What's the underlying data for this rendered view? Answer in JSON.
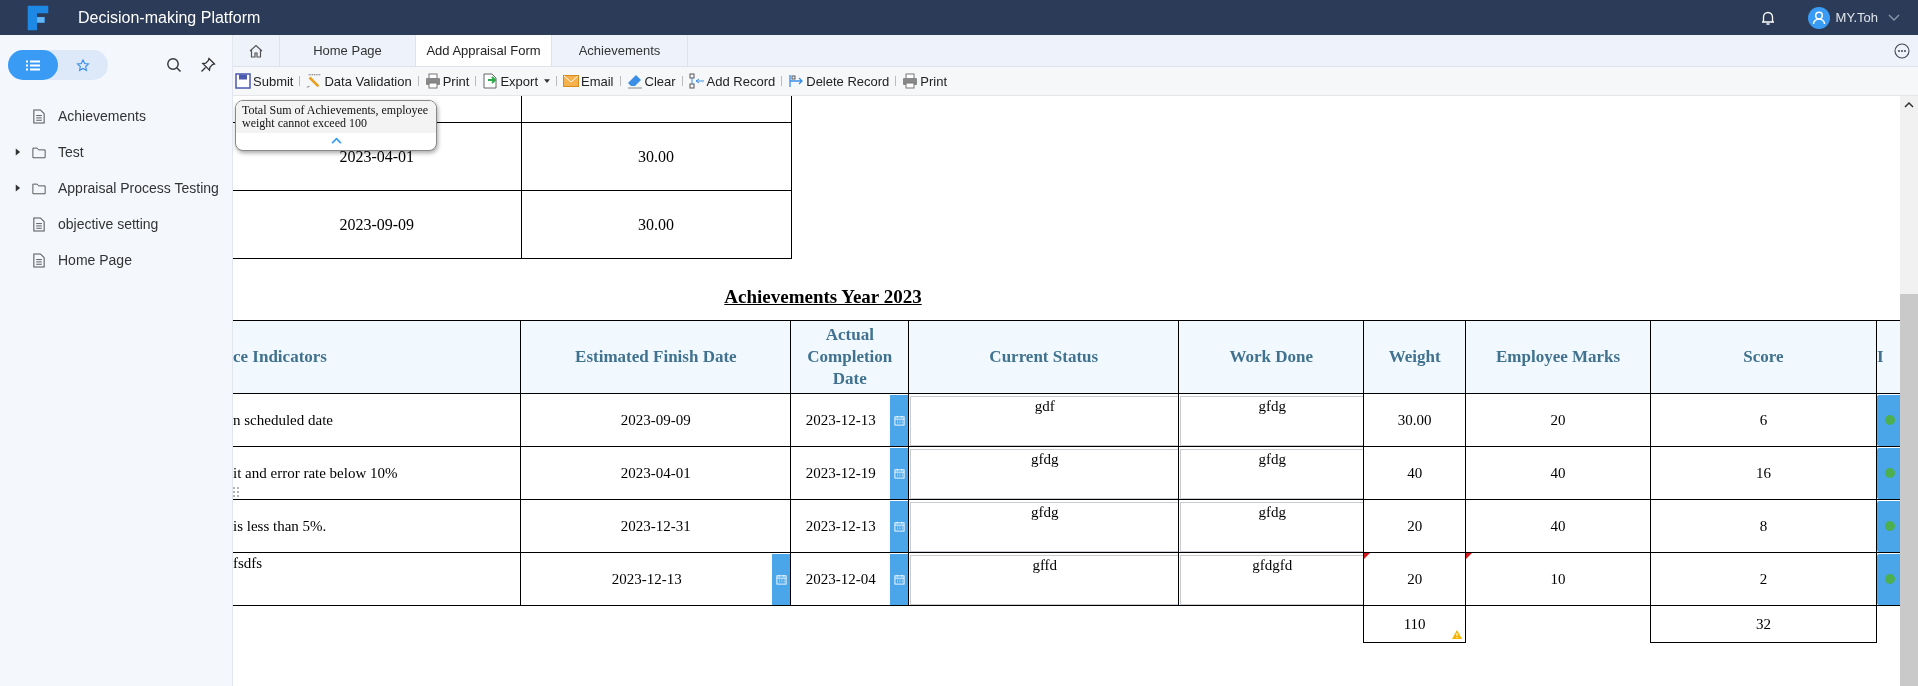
{
  "app": {
    "title": "Decision-making Platform",
    "user": "MY.Toh"
  },
  "sidebar": {
    "views": [
      {
        "kind": "list",
        "selected": true
      },
      {
        "kind": "favorites",
        "selected": false
      }
    ],
    "items": [
      {
        "label": "Achievements",
        "kind": "file"
      },
      {
        "label": "Test",
        "kind": "folder",
        "expanded": false
      },
      {
        "label": "Appraisal Process Testing",
        "kind": "folder",
        "expanded": false
      },
      {
        "label": "objective setting",
        "kind": "file"
      },
      {
        "label": "Home Page",
        "kind": "file"
      }
    ]
  },
  "tabs": [
    {
      "label": "Home Page",
      "selected": false
    },
    {
      "label": "Add Appraisal Form",
      "selected": true
    },
    {
      "label": "Achievements",
      "selected": false
    }
  ],
  "toolbar": [
    {
      "label": "Submit",
      "kind": "submit"
    },
    {
      "label": "Data Validation",
      "kind": "validate"
    },
    {
      "label": "Print",
      "kind": "print"
    },
    {
      "label": "Export",
      "kind": "export"
    },
    {
      "label": "Email",
      "kind": "email"
    },
    {
      "label": "Clear",
      "kind": "clear"
    },
    {
      "label": "Add Record",
      "kind": "add"
    },
    {
      "label": "Delete Record",
      "kind": "delete"
    },
    {
      "label": "Print",
      "kind": "print"
    }
  ],
  "tooltip": "Total Sum of Achievements, employee weight cannot exceed 100",
  "top_table": {
    "rows": [
      {
        "date": "2023-04-01",
        "value": "30.00"
      },
      {
        "date": "2023-09-09",
        "value": "30.00"
      }
    ]
  },
  "achievements": {
    "title": "Achievements Year 2023",
    "columns": [
      "ce Indicators",
      "Estimated Finish Date",
      "Actual Completion Date",
      "Current Status",
      "Work Done",
      "Weight",
      "Employee Marks",
      "Score",
      "I"
    ],
    "rows": [
      {
        "indicator": {
          "text": "n scheduled date",
          "editable": false
        },
        "estimated_finish": {
          "value": "2023-09-09",
          "editable": false
        },
        "actual_completion": "2023-12-13",
        "current_status": "gdf",
        "work_done": "gfdg",
        "weight": {
          "value": "30.00",
          "flagged": false
        },
        "employee_marks": {
          "value": "20",
          "flagged": false
        },
        "score": "6"
      },
      {
        "indicator": {
          "text": "it and error rate below 10%",
          "editable": false
        },
        "estimated_finish": {
          "value": "2023-04-01",
          "editable": false
        },
        "actual_completion": "2023-12-19",
        "current_status": "gfdg",
        "work_done": "gfdg",
        "weight": {
          "value": "40",
          "flagged": false
        },
        "employee_marks": {
          "value": "40",
          "flagged": false
        },
        "score": "16"
      },
      {
        "indicator": {
          "text": "is less than 5%.",
          "editable": false
        },
        "estimated_finish": {
          "value": "2023-12-31",
          "editable": false
        },
        "actual_completion": "2023-12-13",
        "current_status": "gfdg",
        "work_done": "gfdg",
        "weight": {
          "value": "20",
          "flagged": false
        },
        "employee_marks": {
          "value": "40",
          "flagged": false
        },
        "score": "8"
      },
      {
        "indicator": {
          "text": "fsdfs",
          "editable": true
        },
        "estimated_finish": {
          "value": "2023-12-13",
          "editable": true
        },
        "actual_completion": "2023-12-04",
        "current_status": "gffd",
        "work_done": "gfdgfd",
        "weight": {
          "value": "20",
          "flagged": true
        },
        "employee_marks": {
          "value": "10",
          "flagged": true
        },
        "score": "2"
      }
    ],
    "totals": {
      "weight": "110",
      "weight_warning": true,
      "score": "32"
    }
  }
}
